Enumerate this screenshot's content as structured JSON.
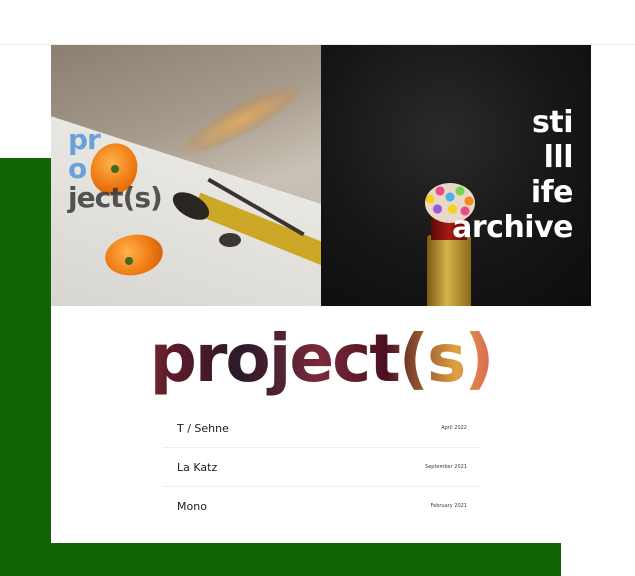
{
  "hero": {
    "left_title_lines": [
      "pr",
      "o",
      "ject(s)"
    ],
    "right_title_lines": [
      "sti",
      "lll",
      "ife",
      "archive"
    ]
  },
  "logo": {
    "text": "project(s)"
  },
  "projects": [
    {
      "title": "T / Sehne",
      "date": "April 2022"
    },
    {
      "title": "La Katz",
      "date": "September 2021"
    },
    {
      "title": "Mono",
      "date": "February 2021"
    }
  ],
  "colors": {
    "green_accent": "#126407",
    "left_title_blue": "#5d9ad8",
    "background": "#ffffff"
  }
}
